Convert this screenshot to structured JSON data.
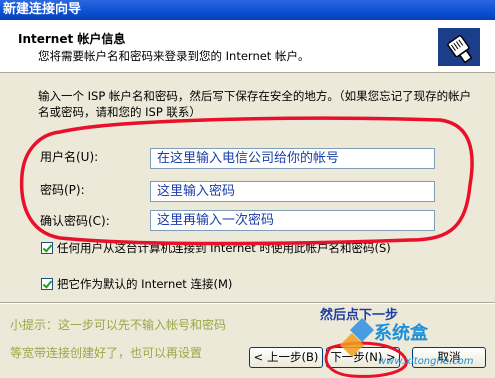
{
  "window": {
    "title": "新建连接向导"
  },
  "header": {
    "title": "Internet 帐户信息",
    "subtitle": "您将需要帐户名和密码来登录到您的 Internet 帐户。"
  },
  "instructions": "输入一个 ISP 帐户名和密码，然后写下保存在安全的地方。（如果您忘记了现存的帐户名或密码，请和您的 ISP 联系）",
  "form": {
    "username": {
      "label": "用户名(U):",
      "value": "在这里输入电信公司给你的帐号"
    },
    "password": {
      "label": "密码(P):",
      "value": "这里输入密码"
    },
    "confirm": {
      "label": "确认密码(C):",
      "value": "这里再输入一次密码"
    }
  },
  "options": {
    "any_user": {
      "label": "任何用户从这台计算机连接到 Internet 时使用此帐户名和密码(S)",
      "checked": true
    },
    "default_connection": {
      "label": "把它作为默认的 Internet 连接(M)",
      "checked": true
    }
  },
  "annotations": {
    "then_next": "然后点下一步",
    "tip_line1": "小提示：这一步可以先不输入帐号和密码",
    "tip_line2": "等宽带连接创建好了，也可以再设置",
    "circle_color": "#e8102a"
  },
  "buttons": {
    "back": "< 上一步(B)",
    "next": "下一步(N) >",
    "cancel": "取消"
  },
  "watermark": {
    "name": "系统盒",
    "url": "www.xitonghe.com"
  }
}
